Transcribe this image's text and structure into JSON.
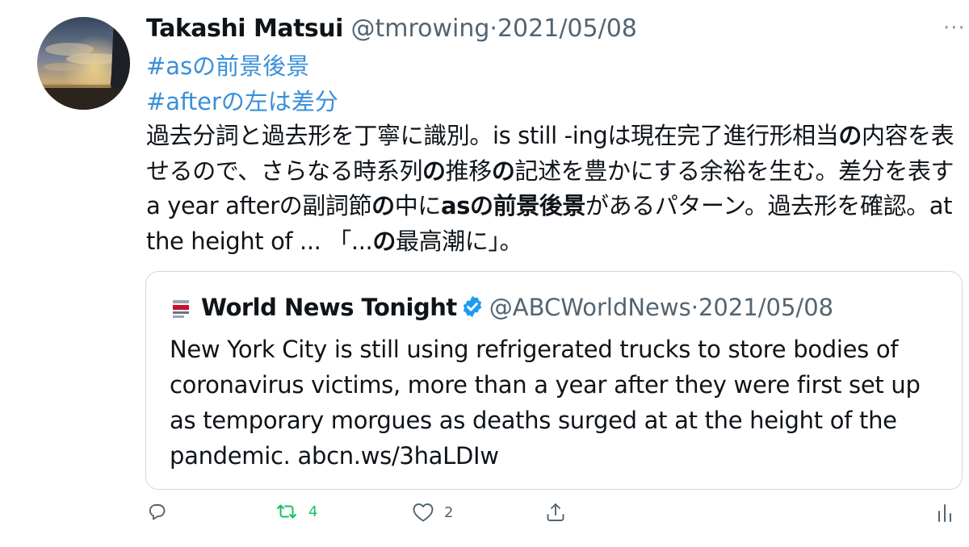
{
  "tweet": {
    "author_name": "Takashi Matsui",
    "author_handle": "@tmrowing",
    "separator": "·",
    "date": "2021/05/08",
    "hashtag_1": "#asの前景後景",
    "hashtag_2": "#afterの左は差分",
    "body": {
      "seg1": "過去分詞と過去形を丁寧に識別。is still -ingは現在完了進行形相当",
      "seg2": "の",
      "seg3": "内容を表せるので、さらなる時系列",
      "seg4": "の",
      "seg5": "推移",
      "seg6": "の",
      "seg7": "記述を豊かにする余裕を生む。差分を表すa year afterの副詞節",
      "seg8": "の",
      "seg9": "中に",
      "seg10": "asの前景後景",
      "seg11": "があるパターン。過去形を確認。at the height of ... 「...",
      "seg12": "の",
      "seg13": "最高潮に」。"
    }
  },
  "quote": {
    "author_name": "World News Tonight",
    "author_handle": "@ABCWorldNews",
    "separator": "·",
    "date": "2021/05/08",
    "text": "New York City is still using refrigerated trucks to store bodies of coronavirus victims, more than a year after they were first set up as temporary morgues as deaths surged at at the height of the pandemic. abcn.ws/3haLDIw"
  },
  "actions": {
    "reply_icon": "reply-icon",
    "retweet_icon": "retweet-icon",
    "retweet_count": "4",
    "like_icon": "heart-icon",
    "like_count": "2",
    "share_icon": "share-icon",
    "analytics_icon": "analytics-icon"
  },
  "colors": {
    "hashtag": "#3b8fd9",
    "secondary_text": "#536471",
    "retweet": "#17bf63",
    "verified": "#1d9bf0",
    "border": "#cfd9de"
  }
}
